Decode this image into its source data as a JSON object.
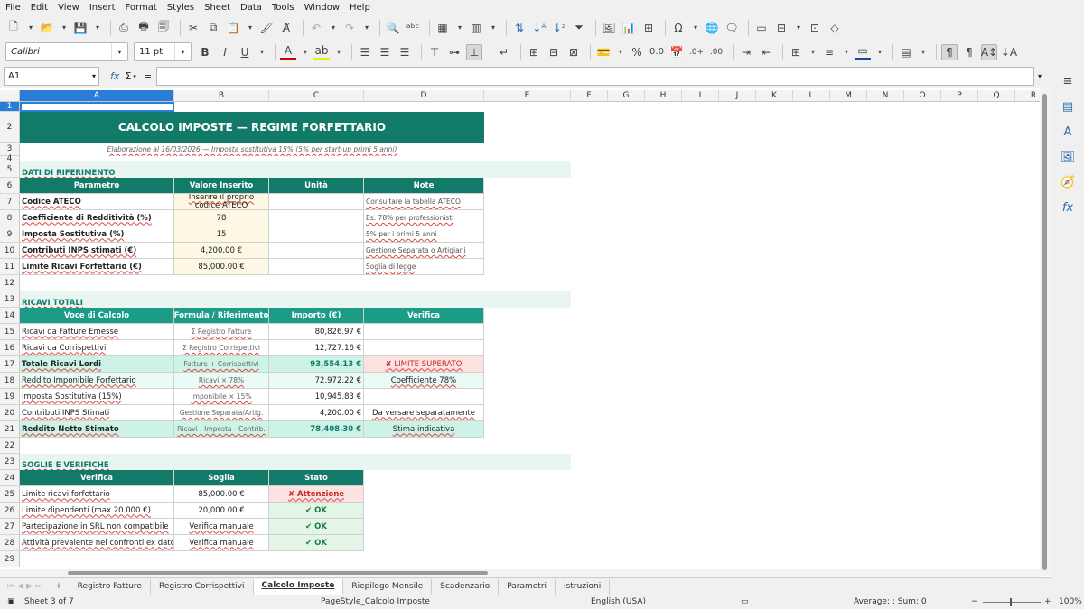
{
  "menu": [
    "File",
    "Edit",
    "View",
    "Insert",
    "Format",
    "Styles",
    "Sheet",
    "Data",
    "Tools",
    "Window",
    "Help"
  ],
  "toolbar": {
    "font_name": "Calibri",
    "font_size": "11 pt",
    "bold": "B",
    "italic": "I",
    "underline": "U",
    "currency": "%",
    "decimal": "0.0"
  },
  "formula_bar": {
    "cell_ref": "A1",
    "fx": "fx",
    "sum": "Σ",
    "eq": "="
  },
  "columns": [
    "A",
    "B",
    "C",
    "D",
    "E",
    "F",
    "G",
    "H",
    "I",
    "J",
    "K",
    "L",
    "M",
    "N",
    "O",
    "P",
    "Q",
    "R"
  ],
  "rows": [
    "1",
    "2",
    "3",
    "4",
    "5",
    "6",
    "7",
    "8",
    "9",
    "10",
    "11",
    "12",
    "13",
    "14",
    "15",
    "16",
    "17",
    "18",
    "19",
    "20",
    "21",
    "22",
    "23",
    "24",
    "25",
    "26",
    "27",
    "28",
    "29"
  ],
  "sheet": {
    "title": "CALCOLO IMPOSTE — REGIME FORFETTARIO",
    "subtitle": "Elaborazione al 16/03/2026  —  Imposta sostitutiva 15% (5% per start-up primi 5 anni)",
    "sec1": "DATI DI RIFERIMENTO",
    "ref_headers": [
      "Parametro",
      "Valore Inserito",
      "Unità",
      "Note"
    ],
    "ref_rows": [
      {
        "p": "Codice ATECO",
        "v": "Inserire il proprio codice ATECO",
        "u": "",
        "n": "Consultare la tabella ATECO"
      },
      {
        "p": "Coefficiente di Redditività (%)",
        "v": "78",
        "u": "",
        "n": "Es: 78% per professionisti"
      },
      {
        "p": "Imposta Sostitutiva (%)",
        "v": "15",
        "u": "",
        "n": "5% per i primi 5 anni"
      },
      {
        "p": "Contributi INPS stimati (€)",
        "v": "4,200.00 €",
        "u": "",
        "n": "Gestione Separata o Artigiani"
      },
      {
        "p": "Limite Ricavi Forfettario (€)",
        "v": "85,000.00 €",
        "u": "",
        "n": "Soglia di legge"
      }
    ],
    "sec2": "RICAVI TOTALI",
    "calc_headers": [
      "Voce di Calcolo",
      "Formula / Riferimento",
      "Importo (€)",
      "Verifica"
    ],
    "calc_rows": [
      {
        "a": "Ricavi da Fatture Emesse",
        "b": "Σ Registro Fatture",
        "c": "80,826.97 €",
        "d": ""
      },
      {
        "a": "Ricavi da Corrispettivi",
        "b": "Σ Registro Corrispettivi",
        "c": "12,727.16 €",
        "d": ""
      },
      {
        "a": "Totale Ricavi Lordi",
        "b": "Fatture + Corrispettivi",
        "c": "93,554.13 €",
        "d": "✘ LIMITE SUPERATO"
      },
      {
        "a": "Reddito Imponibile Forfettario",
        "b": "Ricavi × 78%",
        "c": "72,972.22 €",
        "d": "Coefficiente 78%"
      },
      {
        "a": "Imposta Sostitutiva (15%)",
        "b": "Imponibile × 15%",
        "c": "10,945.83 €",
        "d": ""
      },
      {
        "a": "Contributi INPS Stimati",
        "b": "Gestione Separata/Artig.",
        "c": "4,200.00 €",
        "d": "Da versare separatamente"
      },
      {
        "a": "Reddito Netto Stimato",
        "b": "Ricavi - Imposta - Contrib.",
        "c": "78,408.30 €",
        "d": "Stima indicativa"
      }
    ],
    "sec3": "SOGLIE E VERIFICHE",
    "ver_headers": [
      "Verifica",
      "Soglia",
      "Stato"
    ],
    "ver_rows": [
      {
        "a": "Limite ricavi forfettario",
        "b": "85,000.00 €",
        "c": "✘ Attenzione"
      },
      {
        "a": "Limite dipendenti (max 20.000 €)",
        "b": "20,000.00 €",
        "c": "✔ OK"
      },
      {
        "a": "Partecipazione in SRL non compatibile",
        "b": "Verifica manuale",
        "c": "✔ OK"
      },
      {
        "a": "Attività prevalente nei confronti ex datore",
        "b": "Verifica manuale",
        "c": "✔ OK"
      }
    ]
  },
  "tabs": [
    "Registro Fatture",
    "Registro Corrispettivi",
    "Calcolo Imposte",
    "Riepilogo Mensile",
    "Scadenzario",
    "Parametri",
    "Istruzioni"
  ],
  "status": {
    "sheet": "Sheet 3 of 7",
    "page_style": "PageStyle_Calcolo Imposte",
    "language": "English (USA)",
    "sum": "Average: ; Sum: 0",
    "zoom": "100%"
  },
  "colors": {
    "header": "#127a69",
    "header2": "#1a9c86",
    "warn": "#fde2e2",
    "ok": "#e2f5e6",
    "input": "#fdf8e4"
  }
}
